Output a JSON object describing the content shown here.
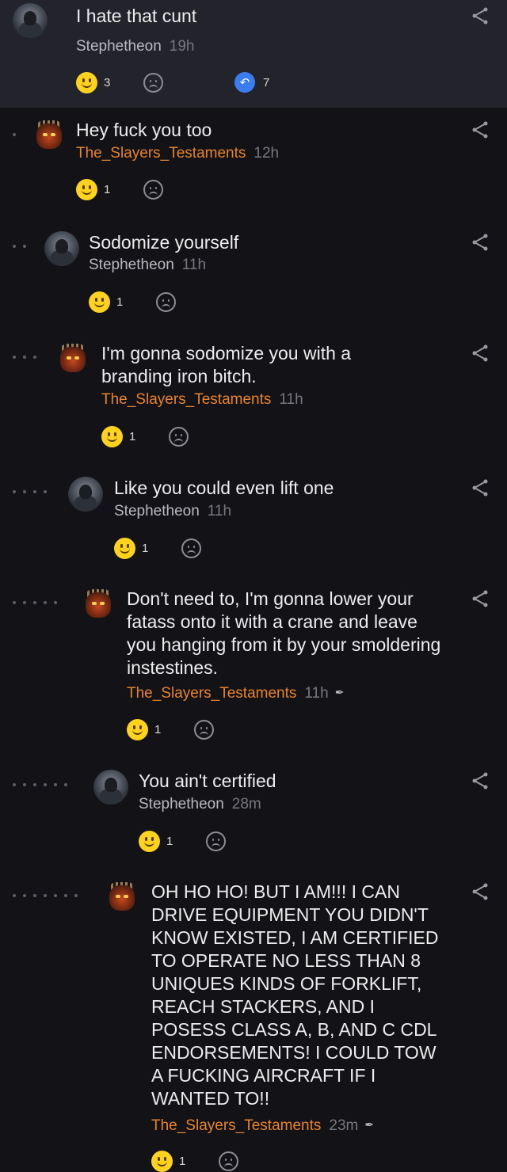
{
  "comments": [
    {
      "text": "I hate that cunt",
      "author": "Stephetheon",
      "time": "19h",
      "smiles": "3",
      "replies": "7",
      "avatar": "steph"
    },
    {
      "text": "Hey fuck you too",
      "author": "The_Slayers_Testaments",
      "time": "12h",
      "smiles": "1",
      "avatar": "slayer"
    },
    {
      "text": "Sodomize yourself",
      "author": "Stephetheon",
      "time": "11h",
      "smiles": "1",
      "avatar": "steph"
    },
    {
      "text": "I'm gonna sodomize you with a branding iron bitch.",
      "author": "The_Slayers_Testaments",
      "time": "11h",
      "smiles": "1",
      "avatar": "slayer"
    },
    {
      "text": "Like you could even lift one",
      "author": "Stephetheon",
      "time": "11h",
      "smiles": "1",
      "avatar": "steph"
    },
    {
      "text": "Don't need to, I'm gonna lower your fatass onto it with a crane and leave you hanging from it by your smoldering instestines.",
      "author": "The_Slayers_Testaments",
      "time": "11h",
      "smiles": "1",
      "edited": true,
      "avatar": "slayer"
    },
    {
      "text": "You ain't certified",
      "author": "Stephetheon",
      "time": "28m",
      "smiles": "1",
      "avatar": "steph"
    },
    {
      "text": "OH HO HO! BUT I AM!!! I CAN DRIVE EQUIPMENT YOU DIDN'T KNOW EXISTED, I AM CERTIFIED TO OPERATE NO LESS THAN 8 UNIQUES KINDS OF FORKLIFT, REACH STACKERS, AND I POSESS CLASS A, B, AND C CDL ENDORSEMENTS! I COULD TOW A FUCKING AIRCRAFT IF I WANTED TO!!",
      "author": "The_Slayers_Testaments",
      "time": "23m",
      "smiles": "1",
      "edited": true,
      "avatar": "slayer"
    }
  ],
  "colors": {
    "background": "#121217",
    "root_background": "#23232b",
    "author_slayer": "#e8842b",
    "reply_badge": "#3b7df0",
    "smile": "#ffd21f"
  },
  "icons": {
    "smile": "smile-reaction-icon",
    "sad": "sad-reaction-icon",
    "share": "share-icon",
    "reply": "reply-count-icon",
    "edit": "edited-pencil-icon"
  }
}
